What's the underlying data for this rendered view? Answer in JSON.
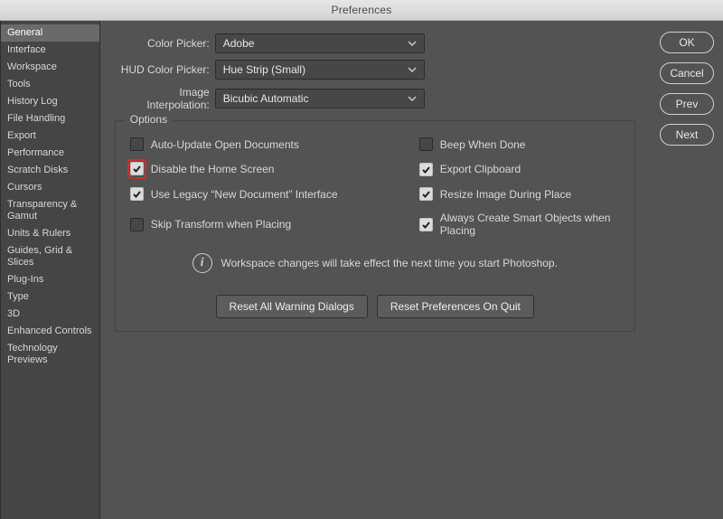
{
  "window": {
    "title": "Preferences"
  },
  "sidebar": {
    "items": [
      {
        "label": "General"
      },
      {
        "label": "Interface"
      },
      {
        "label": "Workspace"
      },
      {
        "label": "Tools"
      },
      {
        "label": "History Log"
      },
      {
        "label": "File Handling"
      },
      {
        "label": "Export"
      },
      {
        "label": "Performance"
      },
      {
        "label": "Scratch Disks"
      },
      {
        "label": "Cursors"
      },
      {
        "label": "Transparency & Gamut"
      },
      {
        "label": "Units & Rulers"
      },
      {
        "label": "Guides, Grid & Slices"
      },
      {
        "label": "Plug-Ins"
      },
      {
        "label": "Type"
      },
      {
        "label": "3D"
      },
      {
        "label": "Enhanced Controls"
      },
      {
        "label": "Technology Previews"
      }
    ],
    "active_index": 0
  },
  "form": {
    "color_picker": {
      "label": "Color Picker:",
      "value": "Adobe"
    },
    "hud_color_picker": {
      "label": "HUD Color Picker:",
      "value": "Hue Strip (Small)"
    },
    "image_interpolation": {
      "label": "Image Interpolation:",
      "value": "Bicubic Automatic"
    }
  },
  "options": {
    "legend": "Options",
    "items": [
      {
        "label": "Auto-Update Open Documents",
        "checked": false
      },
      {
        "label": "Beep When Done",
        "checked": false
      },
      {
        "label": "Disable the Home Screen",
        "checked": true,
        "highlight": true
      },
      {
        "label": "Export Clipboard",
        "checked": true
      },
      {
        "label": "Use Legacy “New Document” Interface",
        "checked": true
      },
      {
        "label": "Resize Image During Place",
        "checked": true
      },
      {
        "label": "Skip Transform when Placing",
        "checked": false
      },
      {
        "label": "Always Create Smart Objects when Placing",
        "checked": true
      }
    ],
    "info_text": "Workspace changes will take effect the next time you start Photoshop.",
    "reset_warnings": "Reset All Warning Dialogs",
    "reset_prefs": "Reset Preferences On Quit"
  },
  "actions": {
    "ok": "OK",
    "cancel": "Cancel",
    "prev": "Prev",
    "next": "Next"
  }
}
